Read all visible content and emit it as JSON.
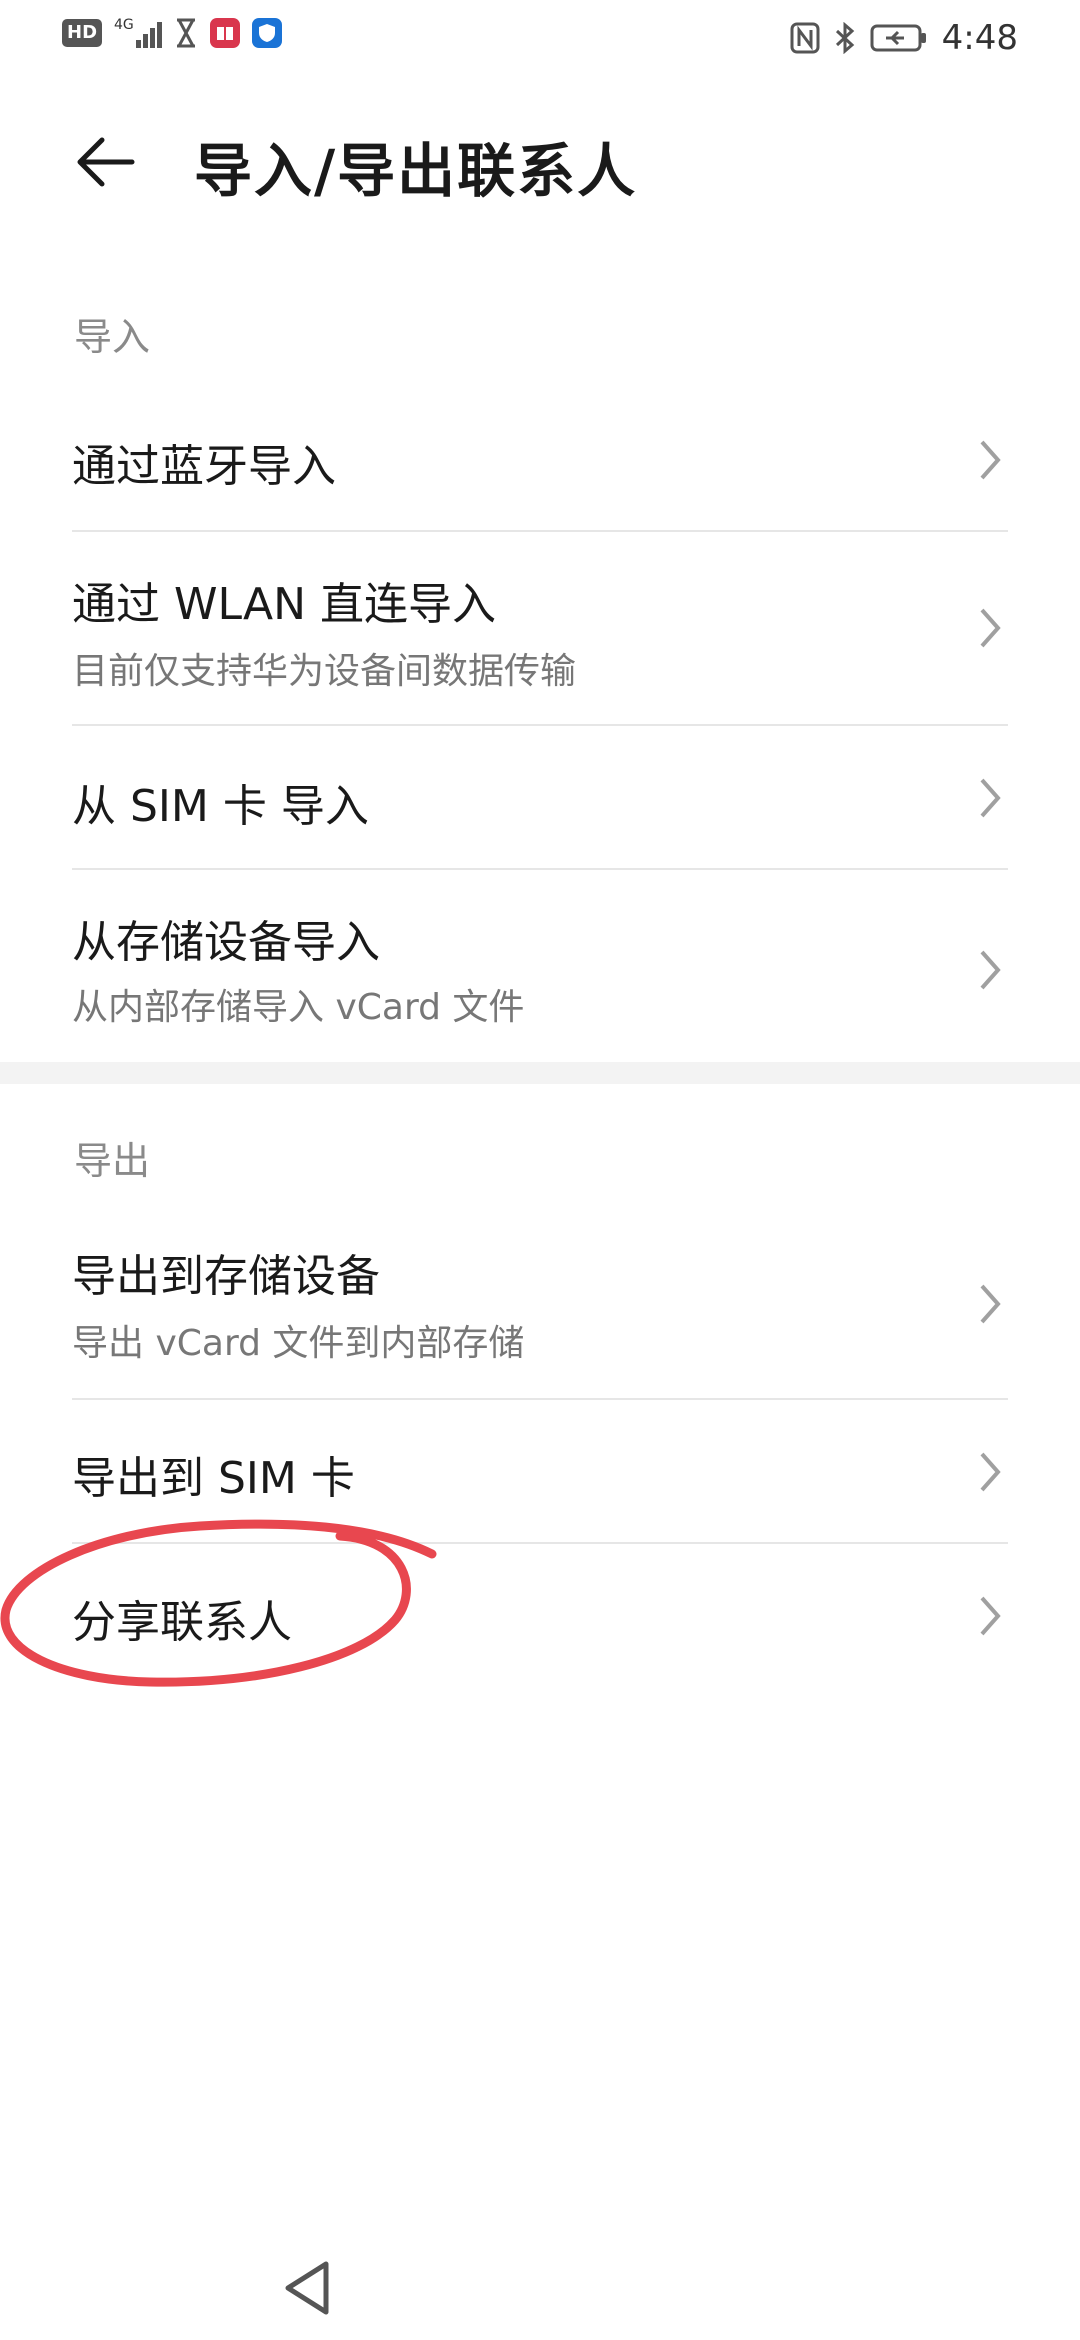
{
  "status_bar": {
    "hd": "HD",
    "network": "4G",
    "time": "4:48"
  },
  "header": {
    "title": "导入/导出联系人"
  },
  "import_section": {
    "label": "导入",
    "items": [
      {
        "title": "通过蓝牙导入"
      },
      {
        "title": "通过 WLAN 直连导入",
        "subtitle": "目前仅支持华为设备间数据传输"
      },
      {
        "title": "从 SIM 卡 导入"
      },
      {
        "title": "从存储设备导入",
        "subtitle": "从内部存储导入 vCard 文件"
      }
    ]
  },
  "export_section": {
    "label": "导出",
    "items": [
      {
        "title": "导出到存储设备",
        "subtitle": "导出 vCard 文件到内部存储"
      },
      {
        "title": "导出到 SIM 卡"
      },
      {
        "title": "分享联系人"
      }
    ]
  },
  "colors": {
    "annotation": "#e8474f",
    "divider": "#e6e6e6",
    "secondary_text": "#777777"
  }
}
